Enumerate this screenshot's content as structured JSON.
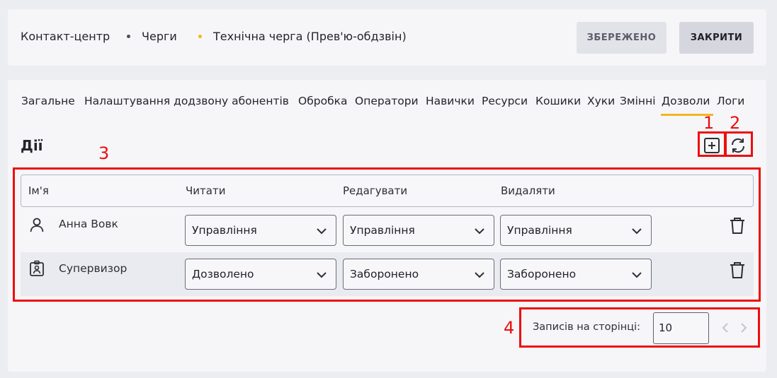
{
  "breadcrumb": [
    {
      "label": "Контакт-центр"
    },
    {
      "label": "Черги",
      "dot_color": "#4a4f5c"
    },
    {
      "label": "Технічна черга (Прев'ю-обдзвін)",
      "dot_color": "#f3b61f"
    }
  ],
  "header_actions": {
    "saved_label": "ЗБЕРЕЖЕНО",
    "close_label": "ЗАКРИТИ"
  },
  "tabs": [
    {
      "label": "Загальне"
    },
    {
      "label": "Налаштування додзвону абонентів"
    },
    {
      "label": "Обробка"
    },
    {
      "label": "Оператори"
    },
    {
      "label": "Навички"
    },
    {
      "label": "Ресурси"
    },
    {
      "label": "Кошики"
    },
    {
      "label": "Хуки"
    },
    {
      "label": "Змінні"
    },
    {
      "label": "Дозволи",
      "active": true
    },
    {
      "label": "Логи"
    }
  ],
  "section": {
    "title": "Дії",
    "add_icon": "plus-square-icon",
    "refresh_icon": "refresh-icon"
  },
  "table": {
    "columns": [
      "Ім'я",
      "Читати",
      "Редагувати",
      "Видаляти"
    ],
    "rows": [
      {
        "icon": "user-icon",
        "name": "Анна Вовк",
        "read": "Управління",
        "edit": "Управління",
        "delete": "Управління"
      },
      {
        "icon": "badge-icon",
        "name": "Супервизор",
        "read": "Дозволено",
        "edit": "Заборонено",
        "delete": "Заборонено"
      }
    ]
  },
  "pagination": {
    "label": "Записів на сторінці:",
    "page_size": "10"
  },
  "annotations": [
    "1",
    "2",
    "3",
    "4"
  ],
  "colors": {
    "accent": "#f3b61f",
    "annotation": "#ee0d0d"
  }
}
